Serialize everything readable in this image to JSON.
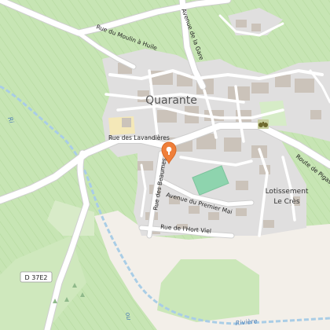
{
  "map": {
    "town_name": "Quarante",
    "place_lotissement_line1": "Lotissement",
    "place_lotissement_line2": "Le Crès",
    "route_shield": "D 37E2",
    "river_name": "Rivière",
    "river_partial_left": "Ri",
    "river_partial_bottom": "ou",
    "roads": {
      "moulin": "Rue du Moulin à Huile",
      "gare": "Avenue de la Gare",
      "lavandieres": "Rue des Lavandières",
      "pigasse": "Route de Pigas",
      "beaumes": "Rue des Beaumes",
      "premier_mai": "Avenue du Premier Mai",
      "hort_viel": "Rue de l'Hort Viel"
    },
    "colors": {
      "vineyard": "#c7e5b4",
      "vine_lines": "#b3d79d",
      "residential": "#e0dfdf",
      "building": "#c8bfb6",
      "road": "#ffffff",
      "road_casing": "#cfcfcf",
      "pitch": "#8ed4ae",
      "sand": "#f4e8b8",
      "pale_area": "#f3efe9",
      "waterway": "#a9cde6",
      "marker": "#ef7f3a"
    },
    "icons": {
      "marker": "map-pin-icon",
      "viewpoint": "binoculars-icon"
    }
  }
}
